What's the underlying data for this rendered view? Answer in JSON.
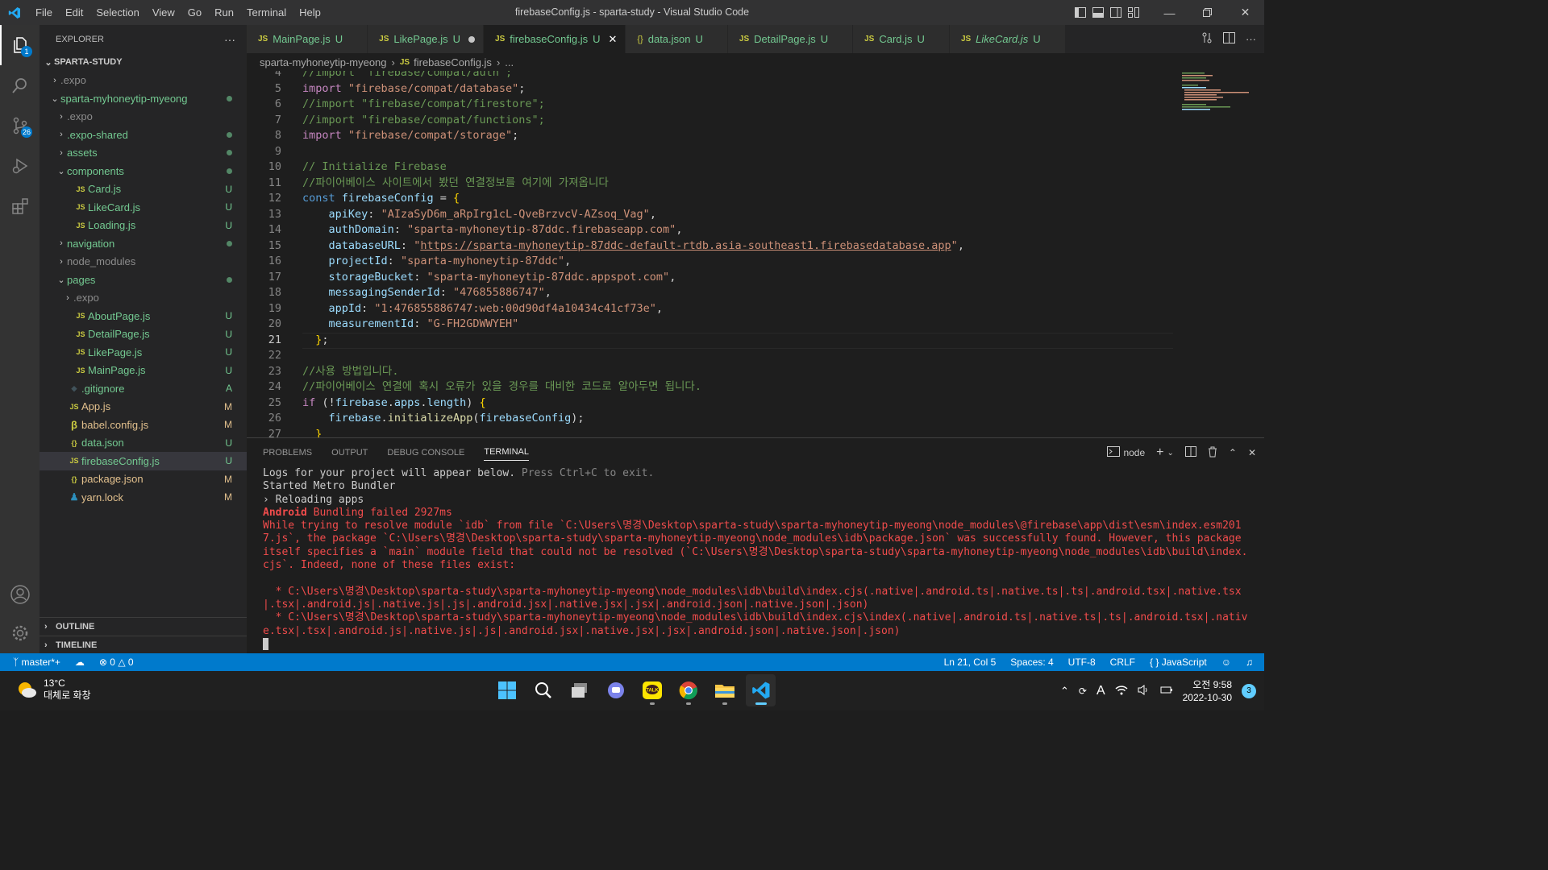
{
  "titlebar": {
    "title": "firebaseConfig.js - sparta-study - Visual Studio Code",
    "menu": [
      "File",
      "Edit",
      "Selection",
      "View",
      "Go",
      "Run",
      "Terminal",
      "Help"
    ]
  },
  "activity": {
    "explorer_badge": "1",
    "scm_badge": "26"
  },
  "explorer": {
    "header": "EXPLORER",
    "root": "SPARTA-STUDY",
    "items": [
      {
        "label": ".expo",
        "indent": 1,
        "kind": "folder",
        "status": ""
      },
      {
        "label": "sparta-myhoneytip-myeong",
        "indent": 1,
        "kind": "folder-open",
        "status": "dot"
      },
      {
        "label": ".expo",
        "indent": 2,
        "kind": "folder",
        "status": ""
      },
      {
        "label": ".expo-shared",
        "indent": 2,
        "kind": "folder",
        "status": "dot"
      },
      {
        "label": "assets",
        "indent": 2,
        "kind": "folder",
        "status": "dot"
      },
      {
        "label": "components",
        "indent": 2,
        "kind": "folder-open",
        "status": "dot"
      },
      {
        "label": "Card.js",
        "indent": 3,
        "kind": "js",
        "status": "U"
      },
      {
        "label": "LikeCard.js",
        "indent": 3,
        "kind": "js",
        "status": "U"
      },
      {
        "label": "Loading.js",
        "indent": 3,
        "kind": "js",
        "status": "U"
      },
      {
        "label": "navigation",
        "indent": 2,
        "kind": "folder",
        "status": "dot"
      },
      {
        "label": "node_modules",
        "indent": 2,
        "kind": "folder",
        "status": ""
      },
      {
        "label": "pages",
        "indent": 2,
        "kind": "folder-open",
        "status": "dot"
      },
      {
        "label": ".expo",
        "indent": 3,
        "kind": "folder",
        "status": ""
      },
      {
        "label": "AboutPage.js",
        "indent": 3,
        "kind": "js",
        "status": "U"
      },
      {
        "label": "DetailPage.js",
        "indent": 3,
        "kind": "js",
        "status": "U"
      },
      {
        "label": "LikePage.js",
        "indent": 3,
        "kind": "js",
        "status": "U"
      },
      {
        "label": "MainPage.js",
        "indent": 3,
        "kind": "js",
        "status": "U"
      },
      {
        "label": ".gitignore",
        "indent": 2,
        "kind": "git",
        "status": "A"
      },
      {
        "label": "App.js",
        "indent": 2,
        "kind": "js",
        "status": "M"
      },
      {
        "label": "babel.config.js",
        "indent": 2,
        "kind": "babel",
        "status": "M"
      },
      {
        "label": "data.json",
        "indent": 2,
        "kind": "json",
        "status": "U"
      },
      {
        "label": "firebaseConfig.js",
        "indent": 2,
        "kind": "js",
        "status": "U",
        "selected": true
      },
      {
        "label": "package.json",
        "indent": 2,
        "kind": "json",
        "status": "M"
      },
      {
        "label": "yarn.lock",
        "indent": 2,
        "kind": "yarn",
        "status": "M"
      }
    ],
    "outline": "OUTLINE",
    "timeline": "TIMELINE"
  },
  "tabs": [
    {
      "label": "MainPage.js",
      "icon": "JS",
      "status": "U"
    },
    {
      "label": "LikePage.js",
      "icon": "JS",
      "status": "U",
      "modified": true
    },
    {
      "label": "firebaseConfig.js",
      "icon": "JS",
      "status": "U",
      "active": true
    },
    {
      "label": "data.json",
      "icon": "{}",
      "status": "U"
    },
    {
      "label": "DetailPage.js",
      "icon": "JS",
      "status": "U"
    },
    {
      "label": "Card.js",
      "icon": "JS",
      "status": "U"
    },
    {
      "label": "LikeCard.js",
      "icon": "JS",
      "status": "U",
      "italic": true
    }
  ],
  "breadcrumb": {
    "folder": "sparta-myhoneytip-myeong",
    "file": "firebaseConfig.js",
    "rest": "..."
  },
  "editor": {
    "current_line": 21,
    "lines": [
      {
        "n": "4",
        "tokens": [
          [
            "cm",
            "//import \"firebase/compat/auth\";"
          ]
        ]
      },
      {
        "n": "5",
        "tokens": [
          [
            "kw",
            "import"
          ],
          [
            "wh",
            " "
          ],
          [
            "str",
            "\"firebase/compat/database\""
          ],
          [
            "wh",
            ";"
          ]
        ]
      },
      {
        "n": "6",
        "tokens": [
          [
            "cm",
            "//import \"firebase/compat/firestore\";"
          ]
        ]
      },
      {
        "n": "7",
        "tokens": [
          [
            "cm",
            "//import \"firebase/compat/functions\";"
          ]
        ]
      },
      {
        "n": "8",
        "tokens": [
          [
            "kw",
            "import"
          ],
          [
            "wh",
            " "
          ],
          [
            "str",
            "\"firebase/compat/storage\""
          ],
          [
            "wh",
            ";"
          ]
        ]
      },
      {
        "n": "9",
        "tokens": []
      },
      {
        "n": "10",
        "tokens": [
          [
            "cm",
            "// Initialize Firebase"
          ]
        ]
      },
      {
        "n": "11",
        "tokens": [
          [
            "cm",
            "//파이어베이스 사이트에서 봤던 연결정보를 여기에 가져옵니다"
          ]
        ]
      },
      {
        "n": "12",
        "tokens": [
          [
            "bl",
            "const"
          ],
          [
            "wh",
            " "
          ],
          [
            "var",
            "firebaseConfig"
          ],
          [
            "wh",
            " = "
          ],
          [
            "br",
            "{"
          ]
        ]
      },
      {
        "n": "13",
        "tokens": [
          [
            "wh",
            "    "
          ],
          [
            "var",
            "apiKey"
          ],
          [
            "wh",
            ": "
          ],
          [
            "str",
            "\"AIzaSyD6m_aRpIrg1cL-QveBrzvcV-AZsoq_Vag\""
          ],
          [
            "wh",
            ","
          ]
        ]
      },
      {
        "n": "14",
        "tokens": [
          [
            "wh",
            "    "
          ],
          [
            "var",
            "authDomain"
          ],
          [
            "wh",
            ": "
          ],
          [
            "str",
            "\"sparta-myhoneytip-87ddc.firebaseapp.com\""
          ],
          [
            "wh",
            ","
          ]
        ]
      },
      {
        "n": "15",
        "tokens": [
          [
            "wh",
            "    "
          ],
          [
            "var",
            "databaseURL"
          ],
          [
            "wh",
            ": "
          ],
          [
            "str",
            "\""
          ],
          [
            "lnk",
            "https://sparta-myhoneytip-87ddc-default-rtdb.asia-southeast1.firebasedatabase.app"
          ],
          [
            "str",
            "\""
          ],
          [
            "wh",
            ","
          ]
        ]
      },
      {
        "n": "16",
        "tokens": [
          [
            "wh",
            "    "
          ],
          [
            "var",
            "projectId"
          ],
          [
            "wh",
            ": "
          ],
          [
            "str",
            "\"sparta-myhoneytip-87ddc\""
          ],
          [
            "wh",
            ","
          ]
        ]
      },
      {
        "n": "17",
        "tokens": [
          [
            "wh",
            "    "
          ],
          [
            "var",
            "storageBucket"
          ],
          [
            "wh",
            ": "
          ],
          [
            "str",
            "\"sparta-myhoneytip-87ddc.appspot.com\""
          ],
          [
            "wh",
            ","
          ]
        ]
      },
      {
        "n": "18",
        "tokens": [
          [
            "wh",
            "    "
          ],
          [
            "var",
            "messagingSenderId"
          ],
          [
            "wh",
            ": "
          ],
          [
            "str",
            "\"476855886747\""
          ],
          [
            "wh",
            ","
          ]
        ]
      },
      {
        "n": "19",
        "tokens": [
          [
            "wh",
            "    "
          ],
          [
            "var",
            "appId"
          ],
          [
            "wh",
            ": "
          ],
          [
            "str",
            "\"1:476855886747:web:00d90df4a10434c41cf73e\""
          ],
          [
            "wh",
            ","
          ]
        ]
      },
      {
        "n": "20",
        "tokens": [
          [
            "wh",
            "    "
          ],
          [
            "var",
            "measurementId"
          ],
          [
            "wh",
            ": "
          ],
          [
            "str",
            "\"G-FH2GDWWYEH\""
          ]
        ]
      },
      {
        "n": "21",
        "tokens": [
          [
            "wh",
            "  "
          ],
          [
            "br",
            "}"
          ],
          [
            "wh",
            ";"
          ]
        ]
      },
      {
        "n": "22",
        "tokens": []
      },
      {
        "n": "23",
        "tokens": [
          [
            "cm",
            "//사용 방법입니다."
          ]
        ]
      },
      {
        "n": "24",
        "tokens": [
          [
            "cm",
            "//파이어베이스 연결에 혹시 오류가 있을 경우를 대비한 코드로 알아두면 됩니다."
          ]
        ]
      },
      {
        "n": "25",
        "tokens": [
          [
            "kw",
            "if"
          ],
          [
            "wh",
            " ("
          ],
          [
            "wh",
            "!"
          ],
          [
            "var",
            "firebase"
          ],
          [
            "wh",
            "."
          ],
          [
            "var",
            "apps"
          ],
          [
            "wh",
            "."
          ],
          [
            "var",
            "length"
          ],
          [
            "wh",
            ") "
          ],
          [
            "br",
            "{"
          ]
        ]
      },
      {
        "n": "26",
        "tokens": [
          [
            "wh",
            "    "
          ],
          [
            "var",
            "firebase"
          ],
          [
            "wh",
            "."
          ],
          [
            "fn",
            "initializeApp"
          ],
          [
            "wh",
            "("
          ],
          [
            "var",
            "firebaseConfig"
          ],
          [
            "wh",
            ");"
          ]
        ]
      },
      {
        "n": "27",
        "tokens": [
          [
            "wh",
            "  "
          ],
          [
            "br",
            "}"
          ]
        ]
      }
    ]
  },
  "panel": {
    "tabs": [
      "PROBLEMS",
      "OUTPUT",
      "DEBUG CONSOLE",
      "TERMINAL"
    ],
    "active_tab": "TERMINAL",
    "shell": "node",
    "terminal": [
      [
        [
          "tl",
          "Logs for your project will appear below. "
        ],
        [
          "tg",
          "Press Ctrl+C to exit."
        ]
      ],
      [
        [
          "tl",
          "Started Metro Bundler"
        ]
      ],
      [
        [
          "tl",
          "› Reloading apps"
        ]
      ],
      [
        [
          "tbold",
          "Android"
        ],
        [
          "tr",
          " Bundling failed 2927ms"
        ]
      ],
      [
        [
          "tr",
          "While trying to resolve module `idb` from file `C:\\Users\\명경\\Desktop\\sparta-study\\sparta-myhoneytip-myeong\\node_modules\\@firebase\\app\\dist\\esm\\index.esm2017.js`, the package `C:\\Users\\명경\\Desktop\\sparta-study\\sparta-myhoneytip-myeong\\node_modules\\idb\\package.json` was successfully found. However, this package itself specifies a `main` module field that could not be resolved (`C:\\Users\\명경\\Desktop\\sparta-study\\sparta-myhoneytip-myeong\\node_modules\\idb\\build\\index.cjs`. Indeed, none of these files exist:"
        ]
      ],
      [
        [
          "tl",
          " "
        ]
      ],
      [
        [
          "tr",
          "  * C:\\Users\\명경\\Desktop\\sparta-study\\sparta-myhoneytip-myeong\\node_modules\\idb\\build\\index.cjs(.native|.android.ts|.native.ts|.ts|.android.tsx|.native.tsx|.tsx|.android.js|.native.js|.js|.android.jsx|.native.jsx|.jsx|.android.json|.native.json|.json)"
        ]
      ],
      [
        [
          "tr",
          "  * C:\\Users\\명경\\Desktop\\sparta-study\\sparta-myhoneytip-myeong\\node_modules\\idb\\build\\index.cjs\\index(.native|.android.ts|.native.ts|.ts|.android.tsx|.native.tsx|.tsx|.android.js|.native.js|.js|.android.jsx|.native.jsx|.jsx|.android.json|.native.json|.json)"
        ]
      ]
    ]
  },
  "statusbar": {
    "branch": "master*+",
    "errors": "0",
    "warnings": "0",
    "position": "Ln 21, Col 5",
    "spaces": "Spaces: 4",
    "encoding": "UTF-8",
    "eol": "CRLF",
    "language": "JavaScript"
  },
  "taskbar": {
    "temp": "13°C",
    "weather": "대체로 화창",
    "ime": "A",
    "time": "오전 9:58",
    "date": "2022-10-30",
    "notifications": "3"
  },
  "colors": {
    "accent": "#007acc",
    "untracked": "#73c991",
    "modified": "#e2c08d",
    "error": "#f14c4c"
  }
}
